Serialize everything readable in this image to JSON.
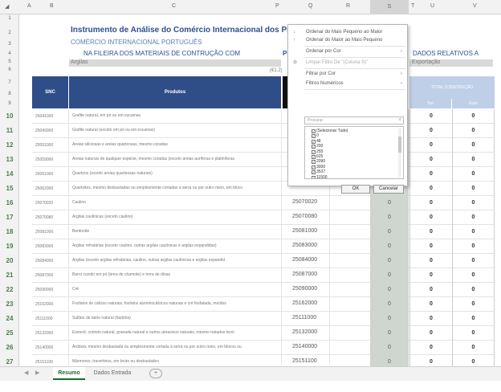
{
  "columns": [
    "A",
    "B",
    "C",
    "P",
    "Q",
    "R",
    "S",
    "T",
    "U",
    "V"
  ],
  "row_numbers": [
    "1",
    "2",
    "3",
    "4",
    "5",
    "6",
    "7",
    "8",
    "9",
    "10",
    "11",
    "12",
    "13",
    "14",
    "15",
    "16",
    "17",
    "18",
    "19",
    "20",
    "21",
    "22",
    "23",
    "24",
    "25",
    "26",
    "27"
  ],
  "titles": {
    "main": "Instrumento de Análise do Comércio Internacional dos Produtos",
    "sub": "COMÉRCIO INTERNACIONAL PORTUGUÊS",
    "fileira": "NA FILEIRA DOS MATERIAIS DE CONTRUÇÃO COM",
    "dados": "DADOS RELATIVOS A",
    "pl": "PI",
    "grupo": "Argilas",
    "fluxo": "Exportação",
    "unit": "(€1.2)"
  },
  "table_header": {
    "nc": "SNC",
    "produtos": "Produtos",
    "total": "TOTAL CONSTRUÇÃO",
    "sub1": "Ton",
    "sub2": "Euro"
  },
  "rows": [
    {
      "nc": "25041000",
      "prod": "Grafite natural, em pó ou em escamas",
      "q": "",
      "s": "0",
      "u": "0",
      "v": "0"
    },
    {
      "nc": "25049000",
      "prod": "Grafite natural (exceto em pó ou em escamas)",
      "q": "",
      "s": "0",
      "u": "0",
      "v": "0"
    },
    {
      "nc": "25051000",
      "prod": "Areias siliciosas e areias quartzosas, mesmo coradas",
      "q": "",
      "s": "0",
      "u": "0",
      "v": "0"
    },
    {
      "nc": "25059000",
      "prod": "Areias naturais de qualquer espécie, mesmo coradas (exceto areias auríferas e platiníferas",
      "q": "",
      "s": "0",
      "u": "0",
      "v": "0"
    },
    {
      "nc": "25061000",
      "prod": "Quartzos (exceto areias quartzosas naturais)",
      "q": "",
      "s": "0",
      "u": "0",
      "v": "0"
    },
    {
      "nc": "25062000",
      "prod": "Quartzites, mesmo desbastadas ou simplesmente cortadas à serra ou por outro meio, em bloco",
      "q": "",
      "s": "0",
      "u": "0",
      "v": "0"
    },
    {
      "nc": "25070020",
      "prod": "Caulino",
      "q": "25070020",
      "s": "0",
      "u": "0",
      "v": "0"
    },
    {
      "nc": "25070080",
      "prod": "Argilas caulínicas (exceto caulino)",
      "q": "25070080",
      "s": "0",
      "u": "0",
      "v": "0"
    },
    {
      "nc": "25081000",
      "prod": "Bentonite",
      "q": "25081000",
      "s": "0",
      "u": "0",
      "v": "0"
    },
    {
      "nc": "25083000",
      "prod": "Argilas refratárias (exceto caulino, outras argilas caulínicas e argilas expandidas)",
      "q": "25083000",
      "s": "0",
      "u": "0",
      "v": "0"
    },
    {
      "nc": "25084000",
      "prod": "Argilas (exceto argilas refratárias, caulino, outras argilas caulínicas e argilas expandid",
      "q": "25084000",
      "s": "0",
      "u": "0",
      "v": "0"
    },
    {
      "nc": "25087000",
      "prod": "Barro cozido em pó (terra de chamote) e terra de dinas",
      "q": "25087000",
      "s": "0",
      "u": "0",
      "v": "0"
    },
    {
      "nc": "25090000",
      "prod": "Cré",
      "q": "25090000",
      "s": "0",
      "u": "0",
      "v": "0"
    },
    {
      "nc": "25162000",
      "prod": "Fosfatos de cálcios naturais, fosfatos aluminocálcicos naturais e cré fosfatada, moídos",
      "q": "25162000",
      "s": "0",
      "u": "0",
      "v": "0"
    },
    {
      "nc": "25111000",
      "prod": "Sulfato de bário natural (baritina)",
      "q": "25111000",
      "s": "0",
      "u": "0",
      "v": "0"
    },
    {
      "nc": "25132000",
      "prod": "Esmeril, corindo natural, granada natural e outros abrasivos naturais, mesmo tratados term",
      "q": "25132000",
      "s": "0",
      "u": "0",
      "v": "0"
    },
    {
      "nc": "25140000",
      "prod": "Ardósia, mesmo desbastada ou simplesmente cortada à serra ou por outro meio, em blocos ou",
      "q": "25140000",
      "s": "0",
      "u": "0",
      "v": "0"
    },
    {
      "nc": "25151100",
      "prod": "Mármores, travertinos, em bruto ou desbastados",
      "q": "25151100",
      "s": "0",
      "u": "0",
      "v": "0"
    }
  ],
  "filter_menu": {
    "items": [
      {
        "label": "Ordenar do Mais Pequeno ao Maior",
        "icon": "sort-asc-icon",
        "disabled": false,
        "submenu": false
      },
      {
        "label": "Ordenar do Maior ao Mais Pequeno",
        "icon": "sort-desc-icon",
        "disabled": false,
        "submenu": false
      },
      {
        "label": "Ordenar por Cor",
        "icon": "",
        "disabled": false,
        "submenu": true
      },
      {
        "label": "Limpar Filtro De \"(Coluna S)\"",
        "icon": "clear-filter-icon",
        "disabled": true,
        "submenu": false
      },
      {
        "label": "Filtrar por Cor",
        "icon": "",
        "disabled": false,
        "submenu": true
      },
      {
        "label": "Filtros Numéricos",
        "icon": "",
        "disabled": false,
        "submenu": true
      }
    ],
    "search_placeholder": "Procurar",
    "checklist": [
      "(Selecionar Tudo)",
      "0",
      "48",
      "200",
      "255",
      "625",
      "2090",
      "3000",
      "3537",
      "11500"
    ],
    "ok": "OK",
    "cancel": "Cancelar"
  },
  "sheet_tabs": [
    "Resumo",
    "Dados Entrada"
  ],
  "add_sheet": "+"
}
